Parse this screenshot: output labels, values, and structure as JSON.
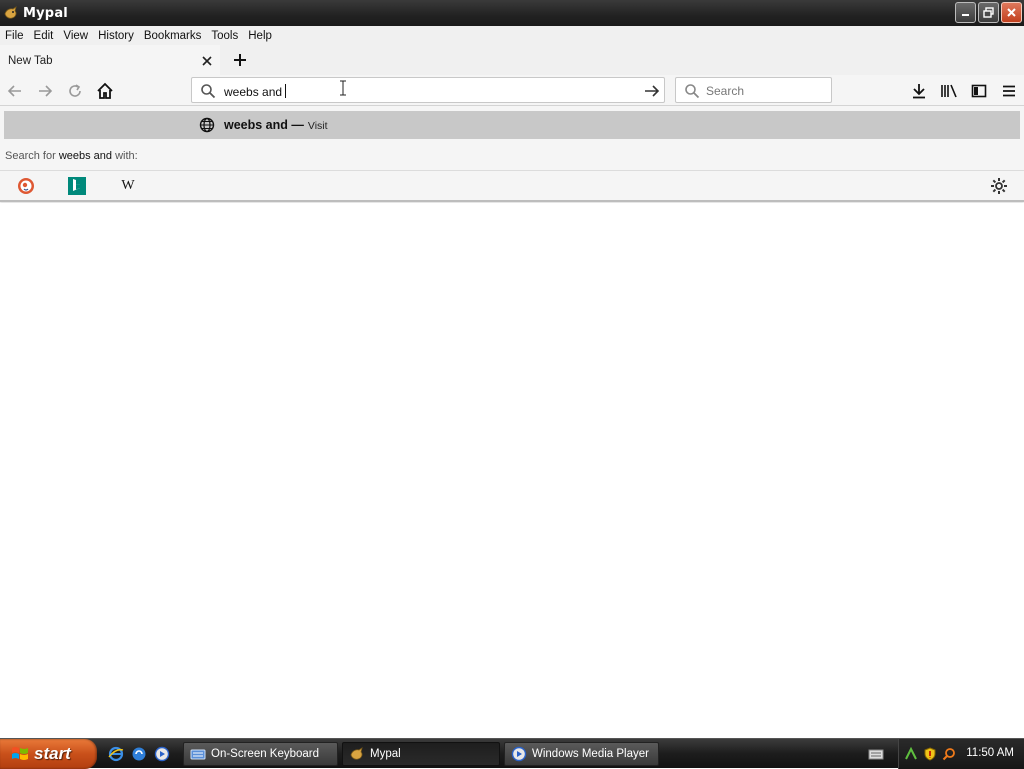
{
  "window": {
    "title": "Mypal",
    "icon": "mypal-app-icon"
  },
  "menu": {
    "items": [
      {
        "label": "File"
      },
      {
        "label": "Edit"
      },
      {
        "label": "View"
      },
      {
        "label": "History"
      },
      {
        "label": "Bookmarks"
      },
      {
        "label": "Tools"
      },
      {
        "label": "Help"
      }
    ]
  },
  "tabs": [
    {
      "label": "New Tab",
      "active": true
    }
  ],
  "navbar": {
    "url_value": "weebs and",
    "search_placeholder": "Search"
  },
  "dropdown": {
    "result": {
      "title": "weebs and",
      "separator": "—",
      "action": "Visit"
    },
    "search_for": {
      "prefix": "Search for",
      "query": "weebs and",
      "suffix": "with:"
    },
    "engines": [
      {
        "name": "duckduckgo-icon"
      },
      {
        "name": "bing-icon"
      },
      {
        "name": "wikipedia-icon",
        "glyph": "W"
      }
    ]
  },
  "taskbar": {
    "start_label": "start",
    "tasks": [
      {
        "label": "On-Screen Keyboard",
        "active": false
      },
      {
        "label": "Mypal",
        "active": true
      },
      {
        "label": "Windows Media Player",
        "active": false
      }
    ],
    "clock": "11:50 AM"
  },
  "colors": {
    "title_bar": "#222222",
    "start_button": "#c9501a",
    "highlight_row": "#c8c8c8",
    "bing": "#00897b"
  }
}
